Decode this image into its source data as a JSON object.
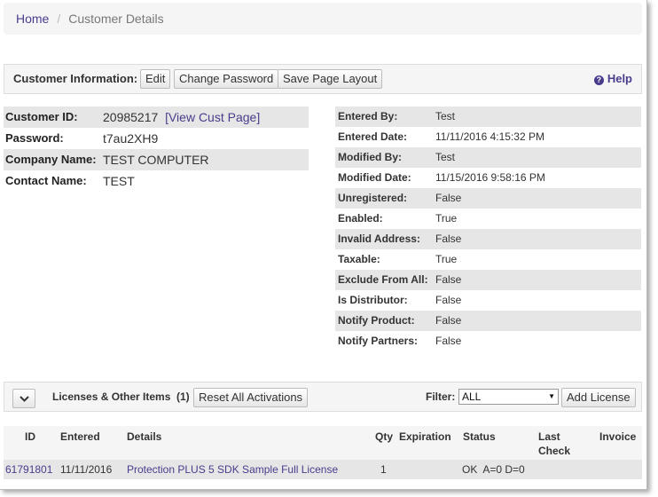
{
  "breadcrumb": {
    "home": "Home",
    "separator": "/",
    "current": "Customer Details"
  },
  "toolbar": {
    "label": "Customer Information:",
    "edit": "Edit",
    "change_password": "Change Password",
    "save_layout": "Save Page Layout",
    "help": "Help",
    "help_icon": "question-circle-icon"
  },
  "customer": {
    "rows": [
      {
        "key": "Customer ID:",
        "value": "20985217"
      },
      {
        "key": "Password:",
        "value": "t7au2XH9"
      },
      {
        "key": "Company Name:",
        "value": "TEST COMPUTER"
      },
      {
        "key": "Contact Name:",
        "value": "TEST"
      }
    ],
    "view_link": "[View Cust Page]"
  },
  "details": {
    "rows": [
      {
        "key": "Entered By:",
        "value": "Test"
      },
      {
        "key": "Entered Date:",
        "value": "11/11/2016 4:15:32 PM"
      },
      {
        "key": "Modified By:",
        "value": "Test"
      },
      {
        "key": "Modified Date:",
        "value": "11/15/2016 9:58:16 PM"
      },
      {
        "key": "Unregistered:",
        "value": "False"
      },
      {
        "key": "Enabled:",
        "value": "True"
      },
      {
        "key": "Invalid Address:",
        "value": "False"
      },
      {
        "key": "Taxable:",
        "value": "True"
      },
      {
        "key": "Exclude From All:",
        "value": "False"
      },
      {
        "key": "Is Distributor:",
        "value": "False"
      },
      {
        "key": "Notify Product:",
        "value": "False"
      },
      {
        "key": "Notify Partners:",
        "value": "False"
      }
    ]
  },
  "licenses": {
    "toggle_icon": "chevron-down-icon",
    "title": "Licenses & Other Items",
    "count": "(1)",
    "reset": "Reset All Activations",
    "filter_label": "Filter:",
    "filter_value": "ALL",
    "add": "Add License",
    "columns": {
      "id": "ID",
      "entered": "Entered",
      "details": "Details",
      "qty": "Qty",
      "expiration": "Expiration",
      "status": "Status",
      "last_check_1": "Last",
      "last_check_2": "Check",
      "invoice": "Invoice"
    },
    "rows": [
      {
        "id": "61791801",
        "entered": "11/11/2016",
        "details": "Protection PLUS 5 SDK Sample Full License",
        "qty": "1",
        "expiration": "",
        "status": "OK  A=0 D=0",
        "last_check": "",
        "invoice": ""
      }
    ]
  },
  "colors": {
    "link": "#4a3c8c",
    "shade": "#e6e6e6",
    "panel": "#f5f5f5"
  }
}
